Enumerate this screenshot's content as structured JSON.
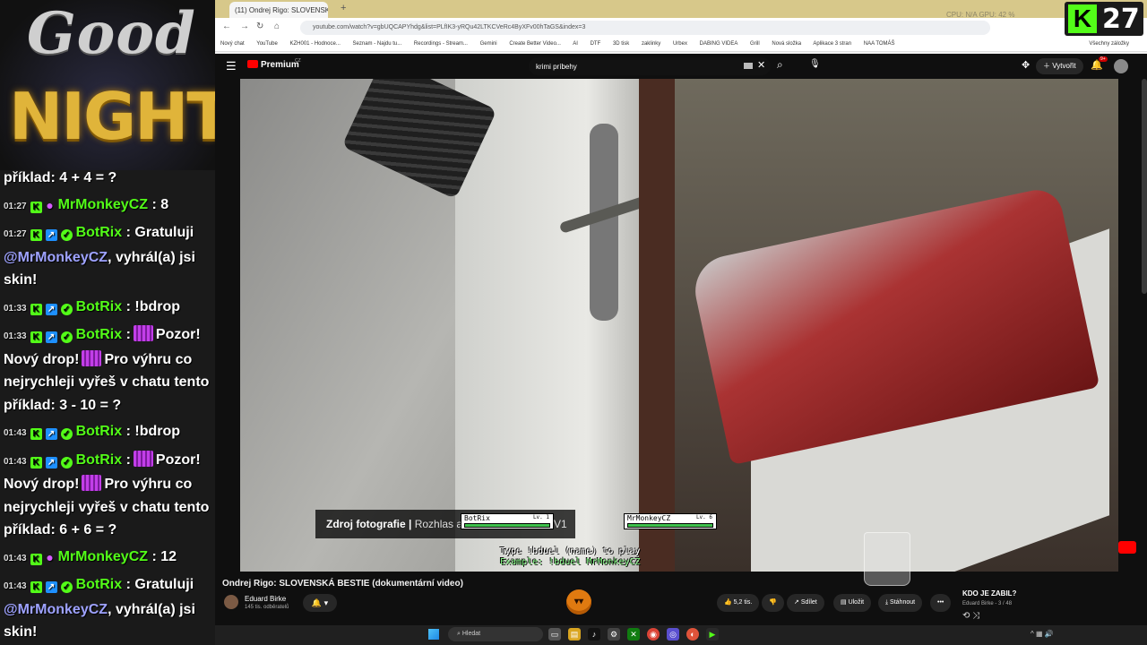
{
  "overlay": {
    "title_good": "Good",
    "title_night": "NIGHT"
  },
  "chat": {
    "messages": [
      {
        "ts": "",
        "user": "",
        "text": "příklad: 4 + 4 = ?"
      },
      {
        "ts": "01:27",
        "user": "MrMonkeyCZ",
        "text": ": 8"
      },
      {
        "ts": "01:27",
        "user": "BotRix",
        "text": ": Gratuluji",
        "mention": "@MrMonkeyCZ",
        "tail": ", vyhrál(a) jsi skin!"
      },
      {
        "ts": "01:33",
        "user": "BotRix",
        "text": ": !bdrop"
      },
      {
        "ts": "01:33",
        "user": "BotRix",
        "text": ":",
        "text2": "Pozor! Nový drop!",
        "text3": "Pro výhru co nejrychleji vyřeš v chatu tento příklad: 3 - 10 = ?"
      },
      {
        "ts": "01:43",
        "user": "BotRix",
        "text": ": !bdrop"
      },
      {
        "ts": "01:43",
        "user": "BotRix",
        "text": ":",
        "text2": "Pozor! Nový drop!",
        "text3": "Pro výhru co nejrychleji vyřeš v chatu tento příklad: 6 + 6 = ?"
      },
      {
        "ts": "01:43",
        "user": "MrMonkeyCZ",
        "text": ": 12"
      },
      {
        "ts": "01:43",
        "user": "BotRix",
        "text": ": Gratuluji",
        "mention": "@MrMonkeyCZ",
        "tail": ", vyhrál(a) jsi skin!"
      }
    ]
  },
  "browser": {
    "tab_title": "(11) Ondrej Rigo: SLOVENSKÁ",
    "new_tab": "+",
    "cpu": "CPU: N/A   GPU: 42 %",
    "url": "youtube.com/watch?v=gbUQCAPYhdg&list=PLfIK3-yRQu42LTKCVeRc4ByXFv00hTaGS&index=3",
    "bookmarks": [
      "Nový chat",
      "YouTube",
      "KZH001 - Hodnoce...",
      "Seznam - Najdu tu...",
      "Recordings - Stream...",
      "Gemini",
      "Create Better Video...",
      "AI",
      "DTF",
      "3D tisk",
      "zaklinky",
      "Urbex",
      "DABING VIDEA",
      "Grill",
      "Nová složka",
      "Aplikace 3 stran",
      "NAA TOMÁŠ"
    ],
    "all_bookmarks": "Všechny záložky"
  },
  "kick": {
    "logo": "K",
    "viewers": "27"
  },
  "youtube": {
    "brand": "Premium",
    "brand_region": "CZ",
    "search_value": "krimi príbehy",
    "create_label": "Vytvořit",
    "notif_count": "9+",
    "caption_bold": "Zdroj fotografie |",
    "caption_src": " Rozhlas a t",
    "caption_suffix": "V1",
    "duel_left_name": "BotRix",
    "duel_left_lv": "Lv. 1",
    "duel_right_name": "MrMonkeyCZ",
    "duel_right_lv": "Lv. 6",
    "duel_line1": "Type !bduel (name) to play",
    "duel_line2": "Example: !bduel MrMonkeyCZ",
    "video_title": "Ondrej Rigo: SLOVENSKÁ BESTIE (dokumentární video)",
    "channel_name": "Eduard Birke",
    "channel_subs": "145 tis. odběratelů",
    "likes": "5,2 tis.",
    "share": "Sdílet",
    "save": "Uložit",
    "download": "Stáhnout",
    "more": "•••",
    "playlist_title": "KDO JE ZABIL?",
    "playlist_sub": "Eduard Birke - 3 / 48"
  },
  "taskbar": {
    "search_placeholder": "Hledat"
  },
  "colors": {
    "kick_green": "#53fc18",
    "youtube_red": "#ff0000",
    "night_gold": "#e0b43a"
  }
}
